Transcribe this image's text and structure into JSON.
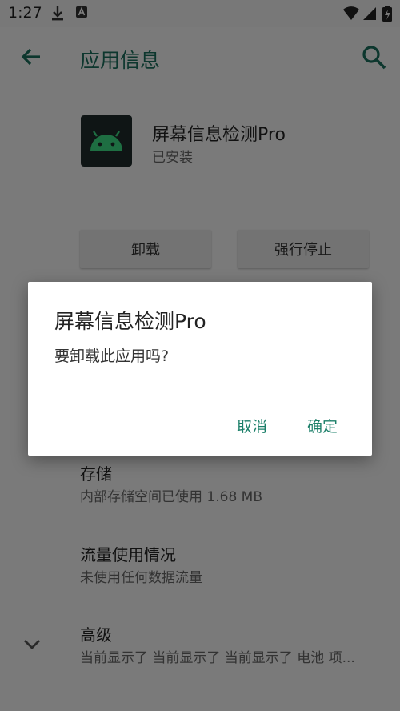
{
  "status_bar": {
    "time": "1:27",
    "icons": [
      "download-icon",
      "text-icon",
      "wifi-icon",
      "signal-icon",
      "battery-icon"
    ]
  },
  "toolbar": {
    "title": "应用信息",
    "back_icon": "arrow-back-icon",
    "search_icon": "search-icon"
  },
  "app": {
    "name": "屏幕信息检测Pro",
    "status": "已安装",
    "icon": "android-icon"
  },
  "actions": {
    "uninstall": "卸载",
    "force_stop": "强行停止"
  },
  "items": [
    {
      "title": "存储",
      "subtitle": "内部存储空间已使用 1.68 MB"
    },
    {
      "title": "流量使用情况",
      "subtitle": "未使用任何数据流量"
    },
    {
      "title": "高级",
      "subtitle": "当前显示了 当前显示了 当前显示了 电池 项..."
    }
  ],
  "dialog": {
    "title": "屏幕信息检测Pro",
    "message": "要卸载此应用吗?",
    "cancel": "取消",
    "confirm": "确定"
  },
  "colors": {
    "accent": "#1b7f69",
    "title": "#1b6e5c"
  }
}
